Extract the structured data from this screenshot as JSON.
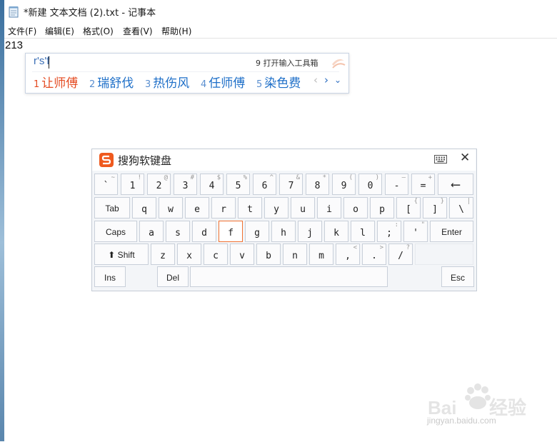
{
  "window": {
    "title": "*新建 文本文档 (2).txt - 记事本"
  },
  "menu": [
    {
      "label": "文件(F)"
    },
    {
      "label": "编辑(E)"
    },
    {
      "label": "格式(O)"
    },
    {
      "label": "查看(V)"
    },
    {
      "label": "帮助(H)"
    }
  ],
  "document": {
    "content": "213"
  },
  "ime": {
    "pinyin": "r's'f",
    "tool_label": "9 打开输入工具箱",
    "candidates": [
      {
        "num": "1",
        "text": "让师傅"
      },
      {
        "num": "2",
        "text": "瑞舒伐"
      },
      {
        "num": "3",
        "text": "热伤风"
      },
      {
        "num": "4",
        "text": "任师傅"
      },
      {
        "num": "5",
        "text": "染色费"
      }
    ],
    "selected_index": 0,
    "accent_color": "#e44a20",
    "candidate_color": "#1e6fc8"
  },
  "keyboard": {
    "title": "搜狗软键盘",
    "close_label": "✕",
    "highlight_color": "#f07030",
    "row1": [
      {
        "m": "`",
        "s": "~"
      },
      {
        "m": "1",
        "s": "!"
      },
      {
        "m": "2",
        "s": "@"
      },
      {
        "m": "3",
        "s": "#"
      },
      {
        "m": "4",
        "s": "$"
      },
      {
        "m": "5",
        "s": "%"
      },
      {
        "m": "6",
        "s": "^"
      },
      {
        "m": "7",
        "s": "&"
      },
      {
        "m": "8",
        "s": "*"
      },
      {
        "m": "9",
        "s": "("
      },
      {
        "m": "0",
        "s": ")"
      },
      {
        "m": "-",
        "s": "—"
      },
      {
        "m": "=",
        "s": "+"
      },
      {
        "m": "⟵",
        "s": ""
      }
    ],
    "row2": [
      {
        "m": "Tab",
        "s": ""
      },
      {
        "m": "q",
        "s": ""
      },
      {
        "m": "w",
        "s": ""
      },
      {
        "m": "e",
        "s": ""
      },
      {
        "m": "r",
        "s": ""
      },
      {
        "m": "t",
        "s": ""
      },
      {
        "m": "y",
        "s": ""
      },
      {
        "m": "u",
        "s": ""
      },
      {
        "m": "i",
        "s": ""
      },
      {
        "m": "o",
        "s": ""
      },
      {
        "m": "p",
        "s": ""
      },
      {
        "m": "[",
        "s": "{"
      },
      {
        "m": "]",
        "s": "}"
      },
      {
        "m": "\\",
        "s": "|"
      }
    ],
    "row3": [
      {
        "m": "Caps",
        "s": ""
      },
      {
        "m": "a",
        "s": ""
      },
      {
        "m": "s",
        "s": ""
      },
      {
        "m": "d",
        "s": ""
      },
      {
        "m": "f",
        "s": ""
      },
      {
        "m": "g",
        "s": ""
      },
      {
        "m": "h",
        "s": ""
      },
      {
        "m": "j",
        "s": ""
      },
      {
        "m": "k",
        "s": ""
      },
      {
        "m": "l",
        "s": ""
      },
      {
        "m": ";",
        "s": ":"
      },
      {
        "m": "'",
        "s": "\""
      },
      {
        "m": "Enter",
        "s": ""
      }
    ],
    "row4": [
      {
        "m": "⬆ Shift",
        "s": ""
      },
      {
        "m": "z",
        "s": ""
      },
      {
        "m": "x",
        "s": ""
      },
      {
        "m": "c",
        "s": ""
      },
      {
        "m": "v",
        "s": ""
      },
      {
        "m": "b",
        "s": ""
      },
      {
        "m": "n",
        "s": ""
      },
      {
        "m": "m",
        "s": ""
      },
      {
        "m": ",",
        "s": "<"
      },
      {
        "m": ".",
        "s": ">"
      },
      {
        "m": "/",
        "s": "?"
      }
    ],
    "row5": [
      {
        "m": "Ins",
        "s": ""
      },
      {
        "m": "Del",
        "s": ""
      },
      {
        "m": "",
        "s": ""
      },
      {
        "m": "Esc",
        "s": ""
      }
    ]
  },
  "watermark": {
    "url": "jingyan.baidu.com"
  }
}
